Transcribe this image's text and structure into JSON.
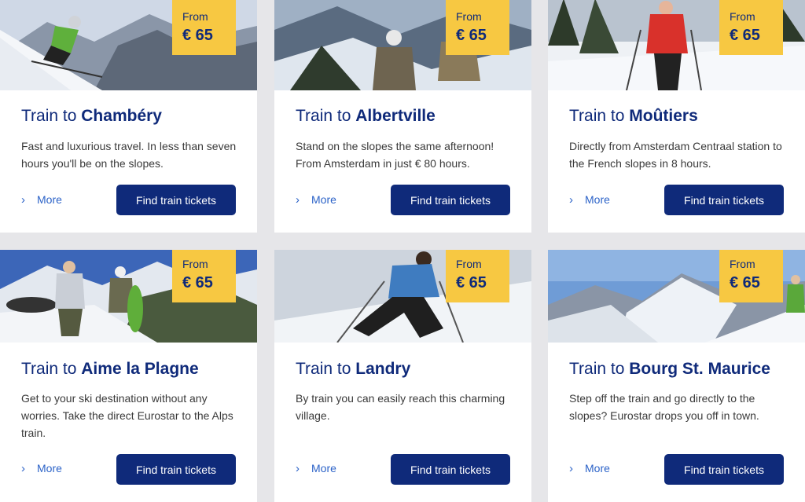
{
  "cards": [
    {
      "price_from": "From",
      "price": "€ 65",
      "title_prefix": "Train to",
      "destination": "Chambéry",
      "description": "Fast and luxurious travel. In less than seven hours you'll be on the slopes.",
      "more": "More",
      "button": "Find train tickets"
    },
    {
      "price_from": "From",
      "price": "€ 65",
      "title_prefix": "Train to",
      "destination": "Albertville",
      "description": "Stand on the slopes the same afternoon! From Amsterdam in just € 80 hours.",
      "more": "More",
      "button": "Find train tickets"
    },
    {
      "price_from": "From",
      "price": "€ 65",
      "title_prefix": "Train to",
      "destination": "Moûtiers",
      "description": "Directly from Amsterdam Centraal station to the French slopes in 8 hours.",
      "more": "More",
      "button": "Find train tickets"
    },
    {
      "price_from": "From",
      "price": "€ 65",
      "title_prefix": "Train to",
      "destination": "Aime la Plagne",
      "description": "Get to your ski destination without any worries. Take the direct Eurostar to the Alps train.",
      "more": "More",
      "button": "Find train tickets"
    },
    {
      "price_from": "From",
      "price": "€ 65",
      "title_prefix": "Train to",
      "destination": "Landry",
      "description": "By train you can easily reach this charming village.",
      "more": "More",
      "button": "Find train tickets"
    },
    {
      "price_from": "From",
      "price": "€ 65",
      "title_prefix": "Train to",
      "destination": "Bourg St. Maurice",
      "description": "Step off the train and go directly to the slopes? Eurostar drops you off in town.",
      "more": "More",
      "button": "Find train tickets"
    }
  ],
  "icons": {
    "more": "chevron-right-icon"
  },
  "colors": {
    "brand_blue": "#0f2a7a",
    "price_yellow": "#f7c842",
    "link_blue": "#2c63c8"
  }
}
